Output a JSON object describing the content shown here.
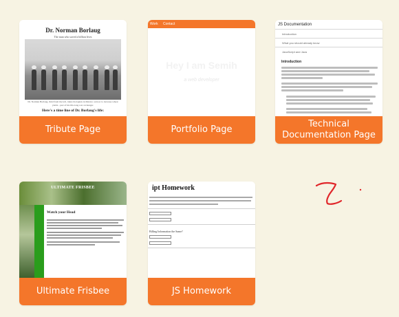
{
  "projects": [
    {
      "caption": "Tribute Page",
      "preview": {
        "title": "Dr. Norman Borlaug",
        "subtitle": "The man who saved a billion lives",
        "photo_caption": "Dr. Norman Borlaug, third from the left, trains biologists in Mexico on how to increase wheat yields - part of his life-long war on hunger.",
        "timeline_heading": "Here's a time line of Dr. Borlaug's life:"
      }
    },
    {
      "caption": "Portfolio Page",
      "preview": {
        "nav": [
          "Work",
          "Contact"
        ],
        "headline": "Hey I am Semih",
        "tagline": "a web developer"
      }
    },
    {
      "caption": "Technical Documentation Page",
      "preview": {
        "doc_title": "JS Documentation",
        "nav_items": [
          "Introduction",
          "What you should already know",
          "JavaScript and Java"
        ],
        "section_heading": "Introduction"
      }
    },
    {
      "caption": "Ultimate Frisbee",
      "preview": {
        "hero_title": "ULTIMATE FRISBEE",
        "content_heading": "Watch your Head"
      }
    },
    {
      "caption": "JS Homework",
      "preview": {
        "heading": "ipt Homework",
        "field_labels": [
          "Billing Information the Same?"
        ]
      }
    }
  ],
  "annotation": {
    "color": "#e0262a"
  },
  "colors": {
    "background": "#f7f3e3",
    "accent": "#f4762a"
  }
}
